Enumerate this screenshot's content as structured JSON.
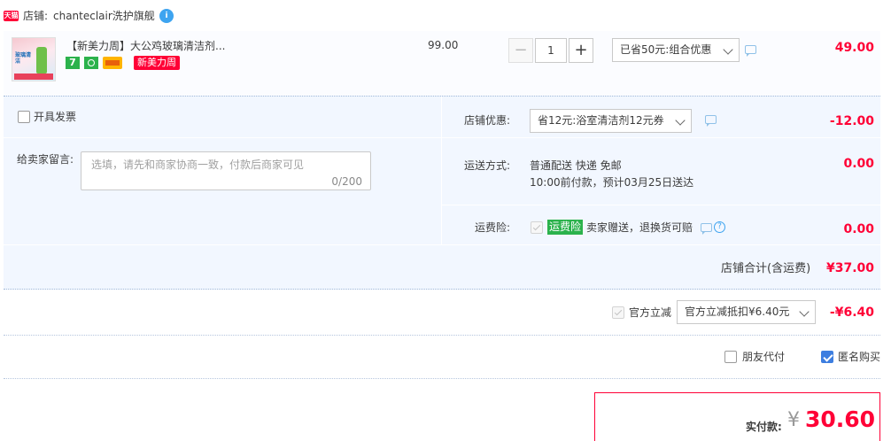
{
  "shop": {
    "badge": "天猫",
    "label": "店铺:",
    "name": "chanteclair洗护旗舰",
    "wangwang_badge": "i"
  },
  "item": {
    "thumb_caption": "玻璃清洁",
    "title": "【新美力周】大公鸡玻璃清洁剂...",
    "icon_seven": "7",
    "promo_tag": "新美力周",
    "unit_price": "99.00",
    "quantity": "1",
    "minus_label": "−",
    "plus_label": "+",
    "discount_select": "已省50元:组合优惠",
    "subtotal": "49.00"
  },
  "invoice": {
    "label": "开具发票"
  },
  "message": {
    "label": "给卖家留言:",
    "placeholder": "选填，请先和商家协商一致，付款后商家可见",
    "counter": "0/200"
  },
  "shop_coupon": {
    "label": "店铺优惠:",
    "select": "省12元:浴室清洁剂12元券",
    "amount": "-12.00"
  },
  "shipping": {
    "label": "运送方式:",
    "method": "普通配送 快递 免邮",
    "eta": "10:00前付款，预计03月25日送达",
    "amount": "0.00"
  },
  "freight_insurance": {
    "label": "运费险:",
    "tag": "运费险",
    "desc": "卖家赠送，退换货可赔",
    "help": "?",
    "amount": "0.00"
  },
  "shop_total": {
    "label": "店铺合计(含运费)",
    "amount": "¥37.00"
  },
  "official_discount": {
    "label": "官方立减",
    "select": "官方立减抵扣¥6.40元",
    "amount": "-¥6.40"
  },
  "options": {
    "friend_pay": "朋友代付",
    "anonymous": "匿名购买"
  },
  "payment": {
    "label": "实付款:",
    "currency": "¥",
    "amount": "30.60"
  },
  "colors": {
    "accent": "#ff0036",
    "panel_bg": "#f2f7ff",
    "link_blue": "#3d7ee0"
  }
}
